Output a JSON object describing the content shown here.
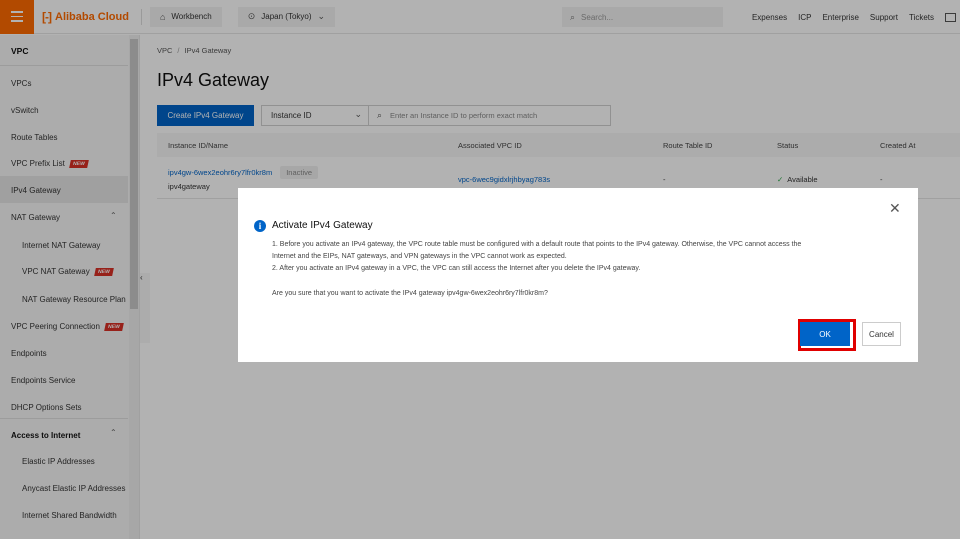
{
  "header": {
    "brand": "Alibaba Cloud",
    "brand_mark": "[-]",
    "workbench": "Workbench",
    "region": "Japan (Tokyo)",
    "search_placeholder": "Search...",
    "nav": [
      "Expenses",
      "ICP",
      "Enterprise",
      "Support",
      "Tickets"
    ]
  },
  "sidebar": {
    "title": "VPC",
    "items": [
      {
        "label": "VPCs"
      },
      {
        "label": "vSwitch"
      },
      {
        "label": "Route Tables"
      },
      {
        "label": "VPC Prefix List",
        "badge": "NEW"
      },
      {
        "label": "IPv4 Gateway"
      },
      {
        "label": "NAT Gateway"
      },
      {
        "label": "Internet NAT Gateway"
      },
      {
        "label": "VPC NAT Gateway",
        "badge": "NEW"
      },
      {
        "label": "NAT Gateway Resource Plan"
      },
      {
        "label": "VPC Peering Connection",
        "badge": "NEW"
      },
      {
        "label": "Endpoints"
      },
      {
        "label": "Endpoints Service"
      },
      {
        "label": "DHCP Options Sets"
      },
      {
        "label": "Access to Internet"
      },
      {
        "label": "Elastic IP Addresses"
      },
      {
        "label": "Anycast Elastic IP Addresses"
      },
      {
        "label": "Internet Shared Bandwidth"
      }
    ]
  },
  "breadcrumb": {
    "root": "VPC",
    "sep": "/",
    "current": "IPv4 Gateway"
  },
  "page_title": "IPv4 Gateway",
  "toolbar": {
    "create_label": "Create IPv4 Gateway",
    "filter_select": "Instance ID",
    "search_placeholder": "Enter an Instance ID to perform exact match"
  },
  "table": {
    "columns": [
      "Instance ID/Name",
      "Associated VPC ID",
      "Route Table ID",
      "Status",
      "Created At"
    ],
    "rows": [
      {
        "id": "ipv4gw-6wex2eohr6ry7lfr0kr8m",
        "name": "ipv4gateway",
        "tag": "Inactive",
        "vpc": "vpc-6wec9gidxlrjhbyag783s",
        "route_table": "-",
        "status": "Available",
        "created": "-"
      }
    ]
  },
  "modal": {
    "title": "Activate IPv4 Gateway",
    "line1": "1. Before you activate an IPv4 gateway, the VPC route table must be configured with a default route that points to the IPv4 gateway. Otherwise, the VPC cannot access the",
    "line2": "Internet and the EIPs, NAT gateways, and VPN gateways in the VPC cannot work as expected.",
    "line3": "2. After you activate an IPv4 gateway in a VPC, the VPC can still access the Internet after you delete the IPv4 gateway.",
    "question": "Are you sure that you want to activate the IPv4 gateway ipv4gw-6wex2eohr6ry7lfr0kr8m?",
    "ok_label": "OK",
    "cancel_label": "Cancel"
  },
  "colors": {
    "brand": "#ff6a00",
    "primary": "#0064c8",
    "highlight": "#e00000",
    "badge": "#d93026"
  }
}
